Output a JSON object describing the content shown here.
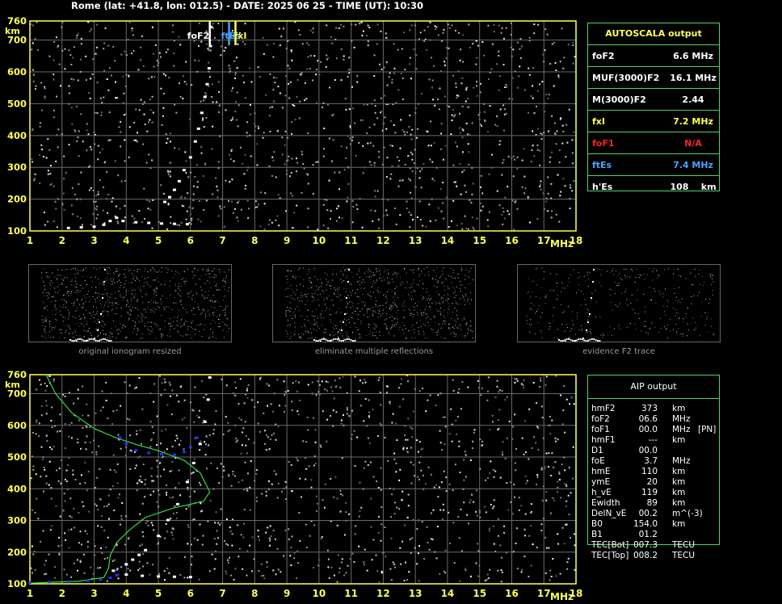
{
  "header": {
    "text": "Rome (lat: +41.8, lon: 012.5) - DATE: 2025 06 25 - TIME (UT): 10:30"
  },
  "chart_data": [
    {
      "type": "scatter",
      "title": "",
      "xlabel": "MHz",
      "ylabel": "km",
      "xlim": [
        1,
        18
      ],
      "ylim": [
        100,
        760
      ],
      "x_ticks": [
        "1",
        "2",
        "3",
        "4",
        "5",
        "6",
        "7",
        "8",
        "9",
        "10",
        "11",
        "12",
        "13",
        "14",
        "15",
        "16",
        "17",
        "18"
      ],
      "y_ticks": [
        "760",
        "700",
        "600",
        "500",
        "400",
        "300",
        "200",
        "100"
      ],
      "grid": true,
      "markers": [
        {
          "label": "foF2",
          "x": 6.6,
          "color": "#ffffff"
        },
        {
          "label": "ftEs",
          "x": 7.2,
          "color": "#4aa3ff"
        },
        {
          "label": "fxI",
          "x": 7.4,
          "color": "#ffff55"
        }
      ],
      "series": [
        {
          "color": "#ffffff",
          "points": [
            [
              2.2,
              108
            ],
            [
              2.6,
              110
            ],
            [
              3.0,
              112
            ],
            [
              3.3,
              118
            ],
            [
              3.5,
              130
            ],
            [
              3.7,
              140
            ],
            [
              3.9,
              130
            ],
            [
              4.3,
              126
            ],
            [
              4.7,
              124
            ],
            [
              5.1,
              122
            ],
            [
              5.5,
              121
            ],
            [
              5.9,
              120
            ],
            [
              5.2,
              190
            ],
            [
              5.35,
              205
            ],
            [
              5.5,
              228
            ],
            [
              5.65,
              255
            ],
            [
              5.8,
              290
            ],
            [
              6.0,
              330
            ],
            [
              6.15,
              380
            ],
            [
              6.25,
              420
            ],
            [
              6.35,
              470
            ],
            [
              6.45,
              520
            ],
            [
              6.52,
              560
            ],
            [
              6.58,
              610
            ],
            [
              6.62,
              680
            ],
            [
              6.64,
              740
            ]
          ]
        }
      ]
    },
    {
      "type": "line",
      "title": "",
      "xlabel": "MHz",
      "ylabel": "km",
      "xlim": [
        1,
        18
      ],
      "ylim": [
        100,
        760
      ],
      "x_ticks": [
        "1",
        "2",
        "3",
        "4",
        "5",
        "6",
        "7",
        "8",
        "9",
        "10",
        "11",
        "12",
        "13",
        "14",
        "15",
        "16",
        "17",
        "18"
      ],
      "y_ticks": [
        "760",
        "700",
        "600",
        "500",
        "400",
        "300",
        "200",
        "100"
      ],
      "grid": true,
      "series": [
        {
          "color": "#33dd44",
          "points": [
            [
              1.5,
              760
            ],
            [
              1.8,
              700
            ],
            [
              2.3,
              640
            ],
            [
              3.0,
              590
            ],
            [
              3.7,
              560
            ],
            [
              4.3,
              540
            ],
            [
              5.0,
              520
            ],
            [
              5.8,
              490
            ],
            [
              6.3,
              450
            ],
            [
              6.6,
              390
            ],
            [
              6.4,
              360
            ],
            [
              5.5,
              340
            ],
            [
              4.6,
              310
            ],
            [
              4.1,
              270
            ],
            [
              3.7,
              230
            ],
            [
              3.5,
              190
            ],
            [
              3.45,
              150
            ],
            [
              3.3,
              120
            ],
            [
              2.5,
              108
            ],
            [
              1.5,
              104
            ],
            [
              1.0,
              102
            ]
          ]
        },
        {
          "color": "#2233ff",
          "points": [
            [
              1.0,
              103
            ],
            [
              1.6,
              104
            ],
            [
              2.2,
              106
            ],
            [
              2.8,
              108
            ],
            [
              3.2,
              112
            ],
            [
              3.5,
              118
            ],
            [
              3.7,
              126
            ],
            [
              3.8,
              560
            ],
            [
              4.0,
              540
            ],
            [
              4.3,
              520
            ],
            [
              4.7,
              512
            ],
            [
              5.1,
              508
            ],
            [
              5.5,
              506
            ],
            [
              5.8,
              515
            ],
            [
              6.0,
              530
            ],
            [
              6.2,
              560
            ]
          ]
        },
        {
          "color": "#ffffff",
          "points": [
            [
              3.6,
              140
            ],
            [
              4.0,
              128
            ],
            [
              4.5,
              124
            ],
            [
              5.0,
              122
            ],
            [
              5.5,
              121
            ],
            [
              6.0,
              120
            ],
            [
              4.0,
              160
            ],
            [
              4.2,
              175
            ],
            [
              4.4,
              190
            ],
            [
              4.6,
              205
            ],
            [
              5.0,
              250
            ],
            [
              5.3,
              300
            ],
            [
              5.6,
              350
            ],
            [
              5.9,
              420
            ],
            [
              6.1,
              480
            ],
            [
              6.3,
              540
            ],
            [
              6.45,
              610
            ],
            [
              6.55,
              680
            ],
            [
              6.6,
              750
            ]
          ]
        }
      ]
    }
  ],
  "autoscala": {
    "title": "AUTOSCALA output",
    "rows": [
      {
        "label": "foF2",
        "value": "6.6 MHz",
        "color": "#ffffff"
      },
      {
        "label": "MUF(3000)F2",
        "value": "16.1 MHz",
        "color": "#ffffff"
      },
      {
        "label": "M(3000)F2",
        "value": "2.44",
        "color": "#ffffff"
      },
      {
        "label": "fxI",
        "value": "7.2 MHz",
        "color": "#ffff55"
      },
      {
        "label": "foF1",
        "value": "N/A",
        "color": "#ff2222"
      },
      {
        "label": "ftEs",
        "value": "7.4 MHz",
        "color": "#4aa3ff"
      },
      {
        "label": "h'Es",
        "value": "108    km",
        "color": "#ffffff"
      }
    ]
  },
  "thumbnails": [
    {
      "caption": "original ionogram resized"
    },
    {
      "caption": "eliminate multiple reflections"
    },
    {
      "caption": "evidence F2 trace"
    }
  ],
  "aip": {
    "title": "AIP output",
    "rows": [
      {
        "name": "hmF2",
        "value": "373",
        "unit": "km",
        "extra": ""
      },
      {
        "name": "foF2",
        "value": "06.6",
        "unit": "MHz",
        "extra": ""
      },
      {
        "name": "foF1",
        "value": "00.0",
        "unit": "MHz",
        "extra": "[PN]"
      },
      {
        "name": "hmF1",
        "value": "---",
        "unit": "km",
        "extra": ""
      },
      {
        "name": "D1",
        "value": "00.0",
        "unit": "",
        "extra": ""
      },
      {
        "name": "foE",
        "value": "3.7",
        "unit": "MHz",
        "extra": ""
      },
      {
        "name": "hmE",
        "value": "110",
        "unit": "km",
        "extra": ""
      },
      {
        "name": "ymE",
        "value": "20",
        "unit": "km",
        "extra": ""
      },
      {
        "name": "h_vE",
        "value": "119",
        "unit": "km",
        "extra": ""
      },
      {
        "name": "Ewidth",
        "value": "89",
        "unit": "km",
        "extra": ""
      },
      {
        "name": "DelN_vE",
        "value": "00.2",
        "unit": "m^(-3)",
        "extra": ""
      },
      {
        "name": "B0",
        "value": "154.0",
        "unit": "km",
        "extra": ""
      },
      {
        "name": "B1",
        "value": "01.2",
        "unit": "",
        "extra": ""
      },
      {
        "name": "TEC[Bot]",
        "value": "007.3",
        "unit": "TECU",
        "extra": ""
      },
      {
        "name": "TEC[Top]",
        "value": "008.2",
        "unit": "TECU",
        "extra": ""
      }
    ]
  }
}
